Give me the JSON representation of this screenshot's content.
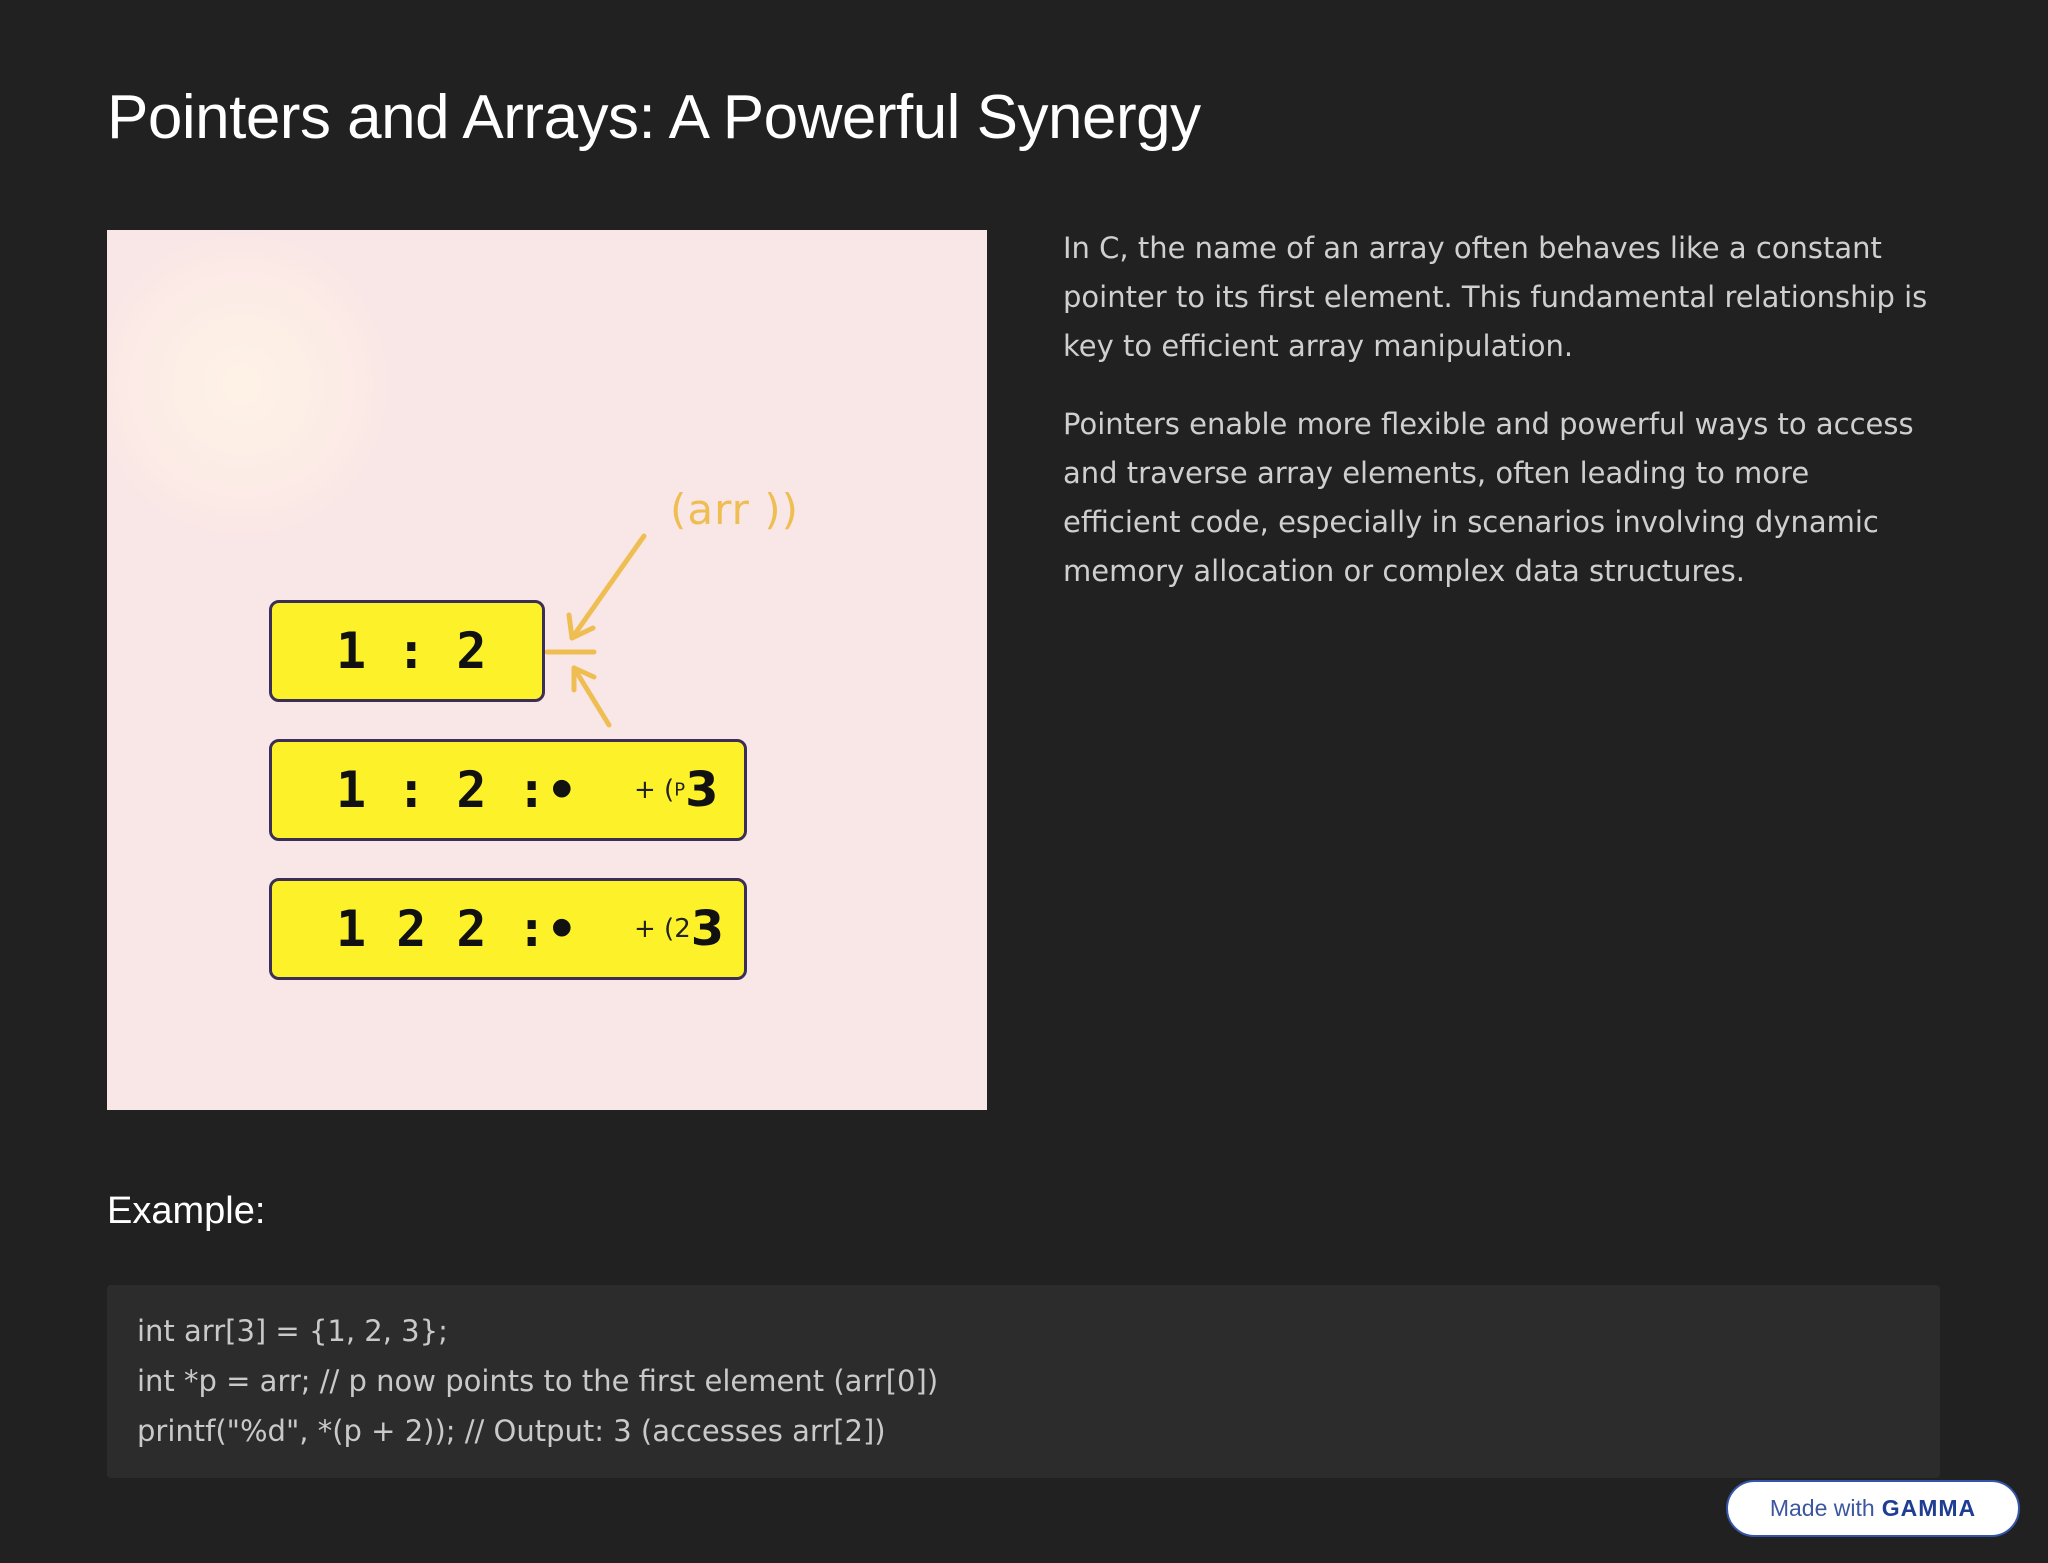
{
  "slide": {
    "title": "Pointers and Arrays: A Powerful Synergy"
  },
  "illustration": {
    "pointer_label": "(arr ))",
    "arrow_color": "#efbe52",
    "cell_color": "#fdf22a",
    "rows": [
      {
        "text": "1 : 2",
        "suffix_prefix": "",
        "suffix_small": "",
        "suffix_big": ""
      },
      {
        "text": "1 : 2 :•",
        "suffix_prefix": "+ (",
        "suffix_small": "P",
        "suffix_big": "3"
      },
      {
        "text": "1 2 2 :•",
        "suffix_prefix": "+ (",
        "suffix_small": "2",
        "suffix_big": "3"
      }
    ]
  },
  "content": {
    "paragraphs": [
      "In C, the name of an array often behaves like a constant pointer to its first element. This fundamental relationship is key to efficient array manipulation.",
      "Pointers enable more flexible and powerful ways to access and traverse array elements, often leading to more efficient code, especially in scenarios involving dynamic memory allocation or complex data structures."
    ]
  },
  "example": {
    "heading": "Example:",
    "code_lines": [
      "int arr[3] = {1, 2, 3};",
      "int *p = arr; // p now points to the first element (arr[0])",
      "printf(\"%d\", *(p + 2)); // Output: 3 (accesses arr[2])"
    ]
  },
  "badge": {
    "prefix": "Made with",
    "brand": "GAMMA",
    "accent_color": "#3556a8"
  }
}
